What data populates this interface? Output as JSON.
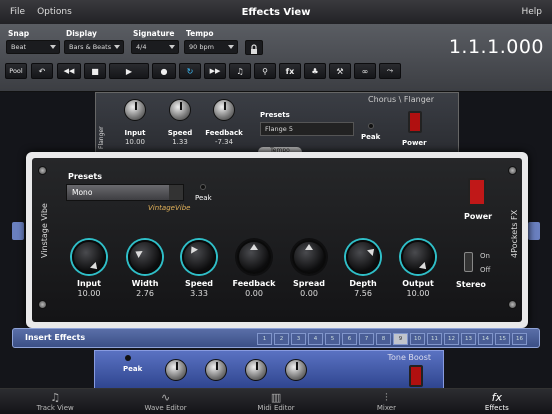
{
  "menu": {
    "file": "File",
    "options": "Options",
    "title": "Effects View",
    "help": "Help"
  },
  "toolbar": {
    "snap": {
      "label": "Snap",
      "value": "Beat"
    },
    "display": {
      "label": "Display",
      "value": "Bars & Beats"
    },
    "signature": {
      "label": "Signature",
      "value": "4/4"
    },
    "tempo": {
      "label": "Tempo",
      "value": "90 bpm"
    },
    "timecode": "1.1.1.000",
    "pool_label": "Pool",
    "fx_label": "fx"
  },
  "chorus": {
    "name": "Chorus \\ Flanger",
    "side_text": "Flanger",
    "presets_label": "Presets",
    "preset": "Flange 5",
    "peak_label": "Peak",
    "power_label": "Power",
    "tempo_label": "Tempo",
    "knobs": [
      {
        "label": "Input",
        "value": "10.00"
      },
      {
        "label": "Speed",
        "value": "1.33"
      },
      {
        "label": "Feedback",
        "value": "-7.34"
      }
    ]
  },
  "vibe": {
    "side_left": "Vinstage Vibe",
    "side_right": "4Pockets FX",
    "presets_label": "Presets",
    "preset": "Mono",
    "brand": "VintageVibe",
    "peak_label": "Peak",
    "power_label": "Power",
    "stereo_label": "Stereo",
    "on_label": "On",
    "off_label": "Off",
    "knobs": [
      {
        "label": "Input",
        "value": "10.00"
      },
      {
        "label": "Width",
        "value": "2.76"
      },
      {
        "label": "Speed",
        "value": "3.33"
      },
      {
        "label": "Feedback",
        "value": "0.00"
      },
      {
        "label": "Spread",
        "value": "0.00"
      },
      {
        "label": "Depth",
        "value": "7.56"
      },
      {
        "label": "Output",
        "value": "10.00"
      }
    ]
  },
  "insert": {
    "label": "Insert Effects",
    "slots": [
      "1",
      "2",
      "3",
      "4",
      "5",
      "6",
      "7",
      "8",
      "9",
      "10",
      "11",
      "12",
      "13",
      "14",
      "15",
      "16"
    ],
    "active_slot": "9"
  },
  "tone_boost": {
    "name": "Tone Boost",
    "peak_label": "Peak"
  },
  "tabs": [
    {
      "label": "Track View",
      "icon": "music-note-icon"
    },
    {
      "label": "Wave Editor",
      "icon": "waveform-icon"
    },
    {
      "label": "Midi Editor",
      "icon": "piano-keys-icon"
    },
    {
      "label": "Mixer",
      "icon": "mixer-faders-icon"
    },
    {
      "label": "Effects",
      "icon": "fx-icon"
    }
  ],
  "active_tab": "Effects"
}
